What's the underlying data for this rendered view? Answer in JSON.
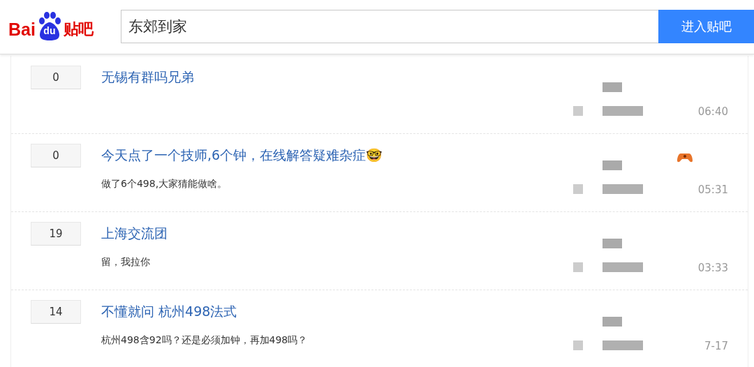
{
  "header": {
    "logo": {
      "latin": "Bai",
      "paw_text": "du",
      "chinese": "贴吧"
    },
    "search": {
      "value": "东郊到家"
    },
    "enter_button": "进入贴吧"
  },
  "threads": [
    {
      "reply_count": "0",
      "title": "无锡有群吗兄弟",
      "time": "06:40",
      "has_badge": false
    },
    {
      "reply_count": "0",
      "title": "今天点了一个技师,6个钟，在线解答疑难杂症🤓",
      "abstract": "做了6个498,大家猜能做啥。",
      "time": "05:31",
      "has_badge": true
    },
    {
      "reply_count": "19",
      "title": "上海交流团",
      "abstract": "留，我拉你",
      "time": "03:33",
      "has_badge": false
    },
    {
      "reply_count": "14",
      "title": "不懂就问 杭州498法式",
      "abstract": "杭州498含92吗？还是必须加钟，再加498吗？",
      "time": "7-17",
      "has_badge": false
    }
  ]
}
